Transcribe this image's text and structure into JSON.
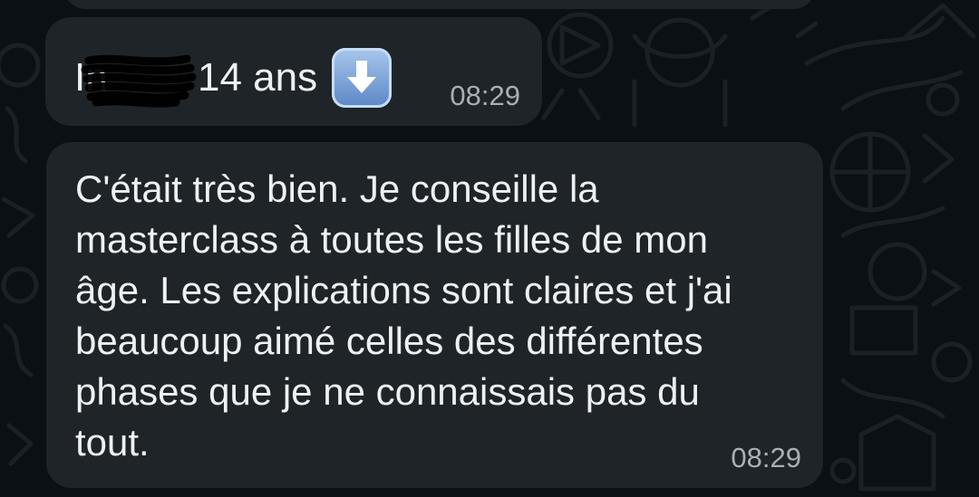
{
  "theme": {
    "chat_background": "#0b1014",
    "bubble_color": "#1f2428",
    "text_color": "#eef1f3",
    "time_color": "#a8b0b6",
    "emoji_color": "#5b87c7"
  },
  "messages": [
    {
      "name_initial": "In",
      "name_redacted": true,
      "text": "14 ans",
      "emoji": "down-arrow-emoji",
      "time": "08:29"
    },
    {
      "text": "C'était très bien. Je conseille la masterclass à toutes les filles de mon âge. Les explications sont claires et j'ai beaucoup aimé celles des différentes phases que je ne connaissais pas du tout.",
      "time": "08:29"
    }
  ]
}
